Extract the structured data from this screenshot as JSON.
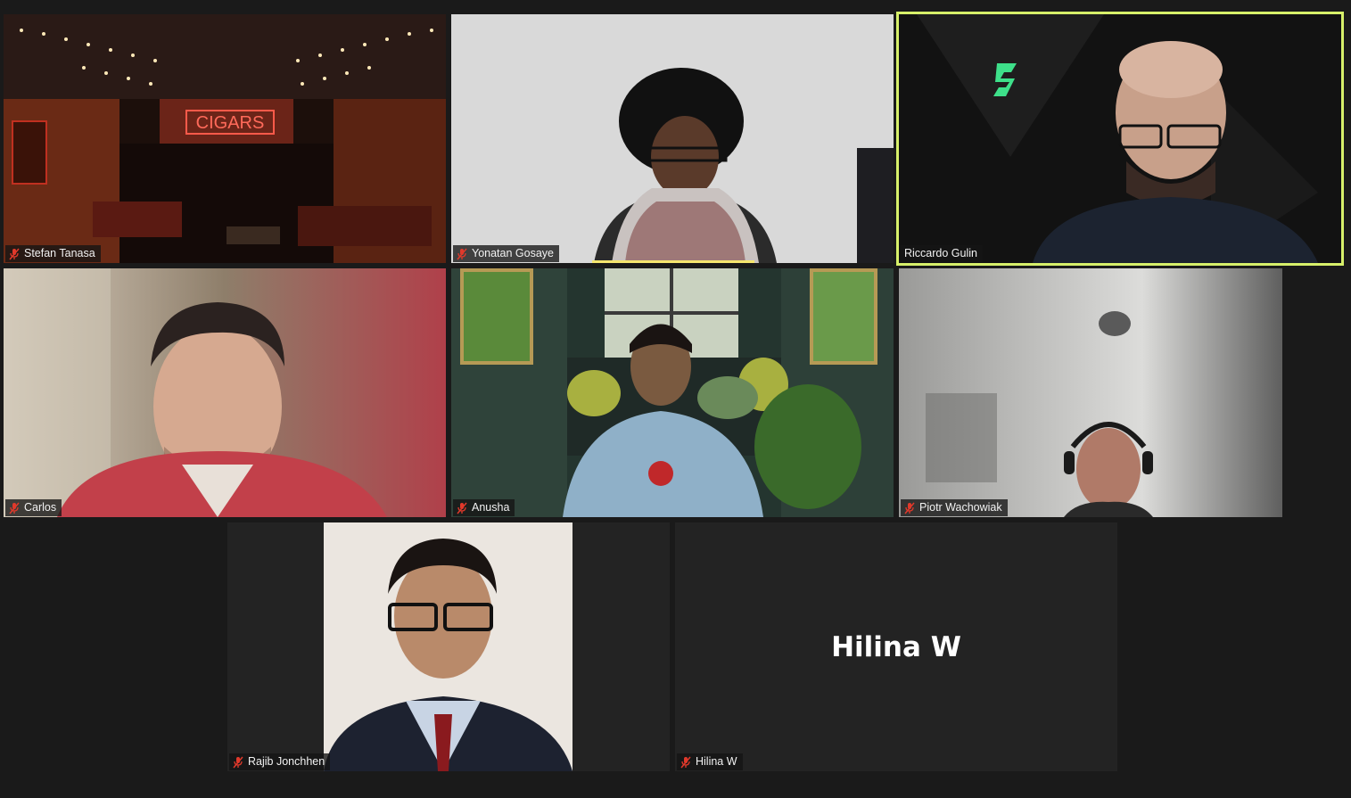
{
  "participants": [
    {
      "name": "Stefan Tanasa",
      "muted": true,
      "video": "cigar-lounge-background",
      "sign_text": "CIGARS"
    },
    {
      "name": "Yonatan Gosaye",
      "muted": true,
      "video": "person-with-scarf",
      "speaking": true
    },
    {
      "name": "Riccardo Gulin",
      "muted": true,
      "video": "bald-man-glasses",
      "active_speaker": true
    },
    {
      "name": "Carlos",
      "muted": true,
      "video": "man-red-sweater"
    },
    {
      "name": "Anusha",
      "muted": true,
      "video": "woman-in-green-room"
    },
    {
      "name": "Piotr Wachowiak",
      "muted": true,
      "video": "man-with-headset-blurred-room"
    },
    {
      "name": "Rajib Jonchhen",
      "muted": true,
      "video": "profile-photo-suit"
    },
    {
      "name": "Hilina W",
      "muted": true,
      "video": "off",
      "display_name": "Hilina W"
    }
  ],
  "colors": {
    "background": "#1a1a1a",
    "tile": "#232323",
    "active_speaker_border": "#d7f06a",
    "speaking_bar": "#f5e66e",
    "muted_icon": "#e0392b"
  }
}
